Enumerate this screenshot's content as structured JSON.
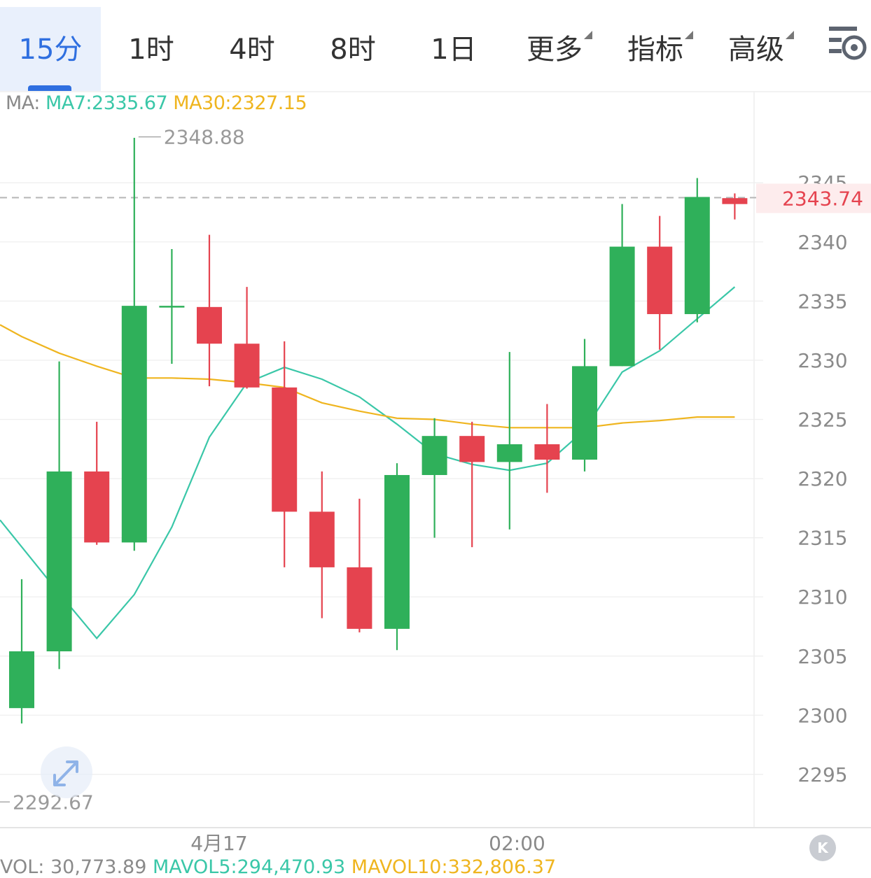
{
  "tabs": [
    {
      "label": "15分",
      "active": true
    },
    {
      "label": "1时"
    },
    {
      "label": "4时"
    },
    {
      "label": "8时"
    },
    {
      "label": "1日"
    },
    {
      "label": "更多",
      "dropdown": true
    },
    {
      "label": "指标",
      "dropdown": true
    },
    {
      "label": "高级",
      "dropdown": true
    }
  ],
  "settings_icon": "chart-settings-icon",
  "ma_legend": {
    "prefix": "MA: ",
    "ma7": "MA7:2335.67",
    "ma30": "MA30:2327.15"
  },
  "vol_legend": {
    "vol": "VOL: 30,773.89",
    "mavol5": "MAVOL5:294,470.93",
    "mavol10": "MAVOL10:332,806.37"
  },
  "colors": {
    "up": "#2fb05a",
    "down": "#e5434f",
    "ma7": "#3ac7a8",
    "ma30": "#efb51f",
    "active_tab": "#2f6fe0",
    "grid": "#eeeeee",
    "axis_text": "#8a8a8a"
  },
  "expand_icon": "expand-icon",
  "k_button": "K",
  "chart_data": {
    "type": "candlestick",
    "ylim": [
      2290.5,
      2352.7
    ],
    "y_ticks": [
      2295,
      2300,
      2305,
      2310,
      2315,
      2320,
      2325,
      2330,
      2335,
      2340,
      2345
    ],
    "x_labels": [
      {
        "label": "4月17",
        "index": 5.26
      },
      {
        "label": "02:00",
        "index": 13.2
      }
    ],
    "current_price": "2343.74",
    "current_price_value": 2343.74,
    "high_label": {
      "text": "2348.88",
      "value": 2348.88,
      "index": 3
    },
    "low_label": {
      "text": "2292.67",
      "value": 2292.67
    },
    "candles": [
      {
        "open": 2300.6,
        "close": 2305.4,
        "high": 2311.5,
        "low": 2299.3
      },
      {
        "open": 2305.4,
        "close": 2320.6,
        "high": 2329.9,
        "low": 2303.9
      },
      {
        "open": 2320.6,
        "close": 2314.6,
        "high": 2324.8,
        "low": 2314.4
      },
      {
        "open": 2314.6,
        "close": 2334.6,
        "high": 2348.8,
        "low": 2313.9
      },
      {
        "open": 2334.6,
        "close": 2334.6,
        "high": 2339.4,
        "low": 2329.7
      },
      {
        "open": 2334.5,
        "close": 2331.4,
        "high": 2340.6,
        "low": 2327.8
      },
      {
        "open": 2331.4,
        "close": 2327.7,
        "high": 2336.2,
        "low": 2327.6
      },
      {
        "open": 2327.7,
        "close": 2317.2,
        "high": 2331.6,
        "low": 2312.5
      },
      {
        "open": 2317.2,
        "close": 2312.5,
        "high": 2320.6,
        "low": 2308.2
      },
      {
        "open": 2312.5,
        "close": 2307.3,
        "high": 2318.3,
        "low": 2307.0
      },
      {
        "open": 2307.3,
        "close": 2320.3,
        "high": 2321.3,
        "low": 2305.5
      },
      {
        "open": 2320.3,
        "close": 2323.6,
        "high": 2325.1,
        "low": 2315.0
      },
      {
        "open": 2323.6,
        "close": 2321.4,
        "high": 2324.8,
        "low": 2314.2
      },
      {
        "open": 2321.4,
        "close": 2322.9,
        "high": 2330.7,
        "low": 2315.7
      },
      {
        "open": 2322.9,
        "close": 2321.6,
        "high": 2326.3,
        "low": 2318.8
      },
      {
        "open": 2321.6,
        "close": 2329.5,
        "high": 2331.8,
        "low": 2320.6
      },
      {
        "open": 2329.5,
        "close": 2339.6,
        "high": 2343.2,
        "low": 2329.5
      },
      {
        "open": 2339.6,
        "close": 2333.9,
        "high": 2342.2,
        "low": 2330.9
      },
      {
        "open": 2333.9,
        "close": 2343.8,
        "high": 2345.4,
        "low": 2333.2
      },
      {
        "open": 2343.7,
        "close": 2343.2,
        "high": 2344.1,
        "low": 2341.9
      }
    ],
    "series": [
      {
        "name": "MA7",
        "values": [
          null,
          2310.3,
          2306.5,
          2310.2,
          2315.9,
          2323.5,
          2328.1,
          2329.4,
          2328.4,
          2326.9,
          2324.6,
          2322.1,
          2321.2,
          2320.7,
          2321.3,
          2324.1,
          2329.0,
          2330.8,
          2333.5,
          2336.2
        ]
      },
      {
        "name": "MA30",
        "values": [
          2332.0,
          2330.6,
          2329.5,
          2328.5,
          2328.5,
          2328.4,
          2328.1,
          2327.7,
          2326.4,
          2325.7,
          2325.1,
          2325.0,
          2324.6,
          2324.3,
          2324.3,
          2324.3,
          2324.7,
          2324.9,
          2325.2,
          2325.2
        ]
      }
    ]
  }
}
